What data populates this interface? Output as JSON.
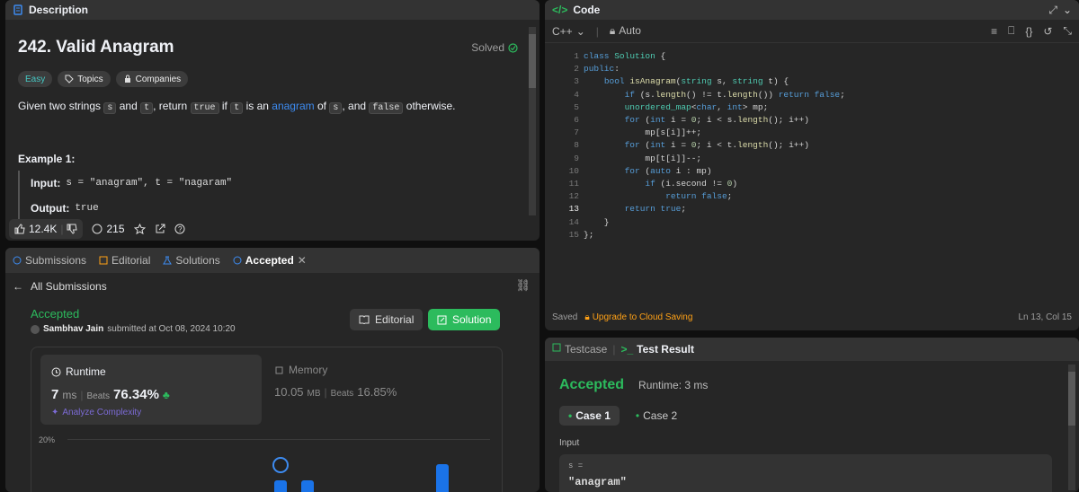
{
  "description": {
    "header": "Description",
    "title": "242. Valid Anagram",
    "solved": "Solved",
    "tags": [
      "Easy",
      "Topics",
      "Companies"
    ],
    "statement": {
      "a": "Given two strings",
      "s": "s",
      "and": "and",
      "t": "t",
      "ret": ", return",
      "true": "true",
      "if": "if",
      "t2": "t",
      "isan": "is an",
      "anagram": "anagram",
      "of": "of",
      "s2": "s",
      "and2": ", and",
      "false": "false",
      "otherwise": "otherwise."
    },
    "example_title": "Example 1:",
    "input_label": "Input:",
    "input_value": "s = \"anagram\", t = \"nagaram\"",
    "output_label": "Output:",
    "output_value": "true",
    "likes": "12.4K",
    "comments": "215"
  },
  "submissions": {
    "tabs": [
      "Submissions",
      "Editorial",
      "Solutions",
      "Accepted"
    ],
    "back": "All Submissions",
    "status": "Accepted",
    "user": "Sambhav Jain",
    "submitted": "submitted at Oct 08, 2024 10:20",
    "editorial_btn": "Editorial",
    "solution_btn": "Solution",
    "runtime_label": "Runtime",
    "runtime_value": "7",
    "runtime_unit": "ms",
    "beats": "Beats",
    "runtime_pct": "76.34%",
    "analyze": "Analyze Complexity",
    "memory_label": "Memory",
    "memory_value": "10.05",
    "memory_unit": "MB",
    "memory_pct": "16.85%",
    "chart_tick": "20%"
  },
  "code": {
    "header": "Code",
    "lang": "C++",
    "auto": "Auto",
    "lines": [
      "1",
      "2",
      "3",
      "4",
      "5",
      "6",
      "7",
      "8",
      "9",
      "10",
      "11",
      "12",
      "13",
      "14",
      "15"
    ],
    "saved": "Saved",
    "upgrade": "Upgrade to Cloud Saving",
    "position": "Ln 13, Col 15"
  },
  "test": {
    "tabs": [
      "Testcase",
      "Test Result"
    ],
    "status": "Accepted",
    "runtime": "Runtime: 3 ms",
    "cases": [
      "Case 1",
      "Case 2"
    ],
    "input_label": "Input",
    "var": "s =",
    "value": "\"anagram\""
  },
  "colors": {
    "accent": "#2cbb5d",
    "link": "#3d8bf0",
    "easy": "#46c6c2",
    "upgrade": "#ffa116"
  }
}
